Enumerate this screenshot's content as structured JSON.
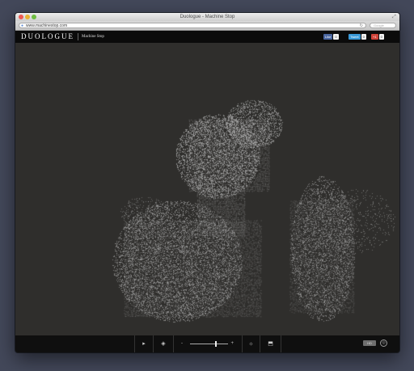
{
  "window": {
    "title": "Duologue - Machine Stop"
  },
  "browser": {
    "url": "www.machinestop.com",
    "search_placeholder": "Google"
  },
  "site": {
    "logo": "DUOLOGUE",
    "subtitle": "Machine Stop",
    "share": {
      "like_label": "Like",
      "like_count": "0",
      "tweet_label": "Tweet",
      "tweet_count": "0",
      "gplus_label": "+1",
      "gplus_count": "0"
    }
  },
  "controls": {
    "play_icon": "▸",
    "gyro_icon": "◈",
    "zoom_minus": "-",
    "zoom_plus": "+",
    "zoom_level": 0.64,
    "light_icon": "☼",
    "export_icon": "⬒",
    "hd_label": "HD",
    "shutter_icon": "◎"
  },
  "colors": {
    "background": "#2f2e2c",
    "point_cloud": "#a9a9a9",
    "header": "#0b0b0b"
  }
}
